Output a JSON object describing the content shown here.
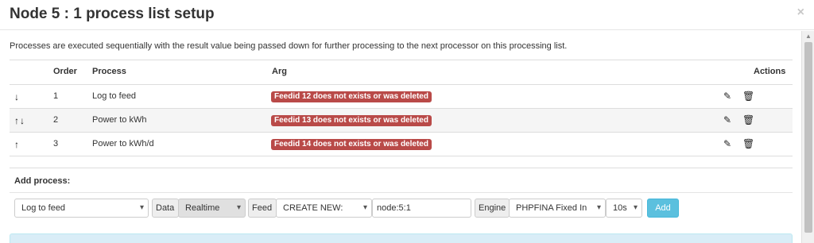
{
  "modal": {
    "title": "Node 5 : 1 process list setup",
    "close": "×"
  },
  "intro": "Processes are executed sequentially with the result value being passed down for further processing to the next processor on this processing list.",
  "table": {
    "headers": {
      "order": "Order",
      "process": "Process",
      "arg": "Arg",
      "actions": "Actions"
    },
    "rows": [
      {
        "arrows": "↓",
        "order": "1",
        "process": "Log to feed",
        "arg": "Feedid 12 does not exists or was deleted"
      },
      {
        "arrows": "↑↓",
        "order": "2",
        "process": "Power to kWh",
        "arg": "Feedid 13 does not exists or was deleted"
      },
      {
        "arrows": "↑",
        "order": "3",
        "process": "Power to kWh/d",
        "arg": "Feedid 14 does not exists or was deleted"
      }
    ],
    "icons": {
      "edit": "edit-icon",
      "delete": "trash-icon"
    }
  },
  "add_process": {
    "label": "Add process:",
    "process_select": "Log to feed",
    "data_label": "Data",
    "data_select": "Realtime",
    "feed_label": "Feed",
    "feed_select": "CREATE NEW:",
    "feed_name": "node:5:1",
    "engine_label": "Engine",
    "engine_select": "PHPFINA Fixed In",
    "interval_select": "10s",
    "add_button": "Add"
  },
  "colors": {
    "error_badge": "#b94a48",
    "add_button": "#5bc0de",
    "info_box": "#d9edf7",
    "row_stripe": "#f5f5f5"
  }
}
